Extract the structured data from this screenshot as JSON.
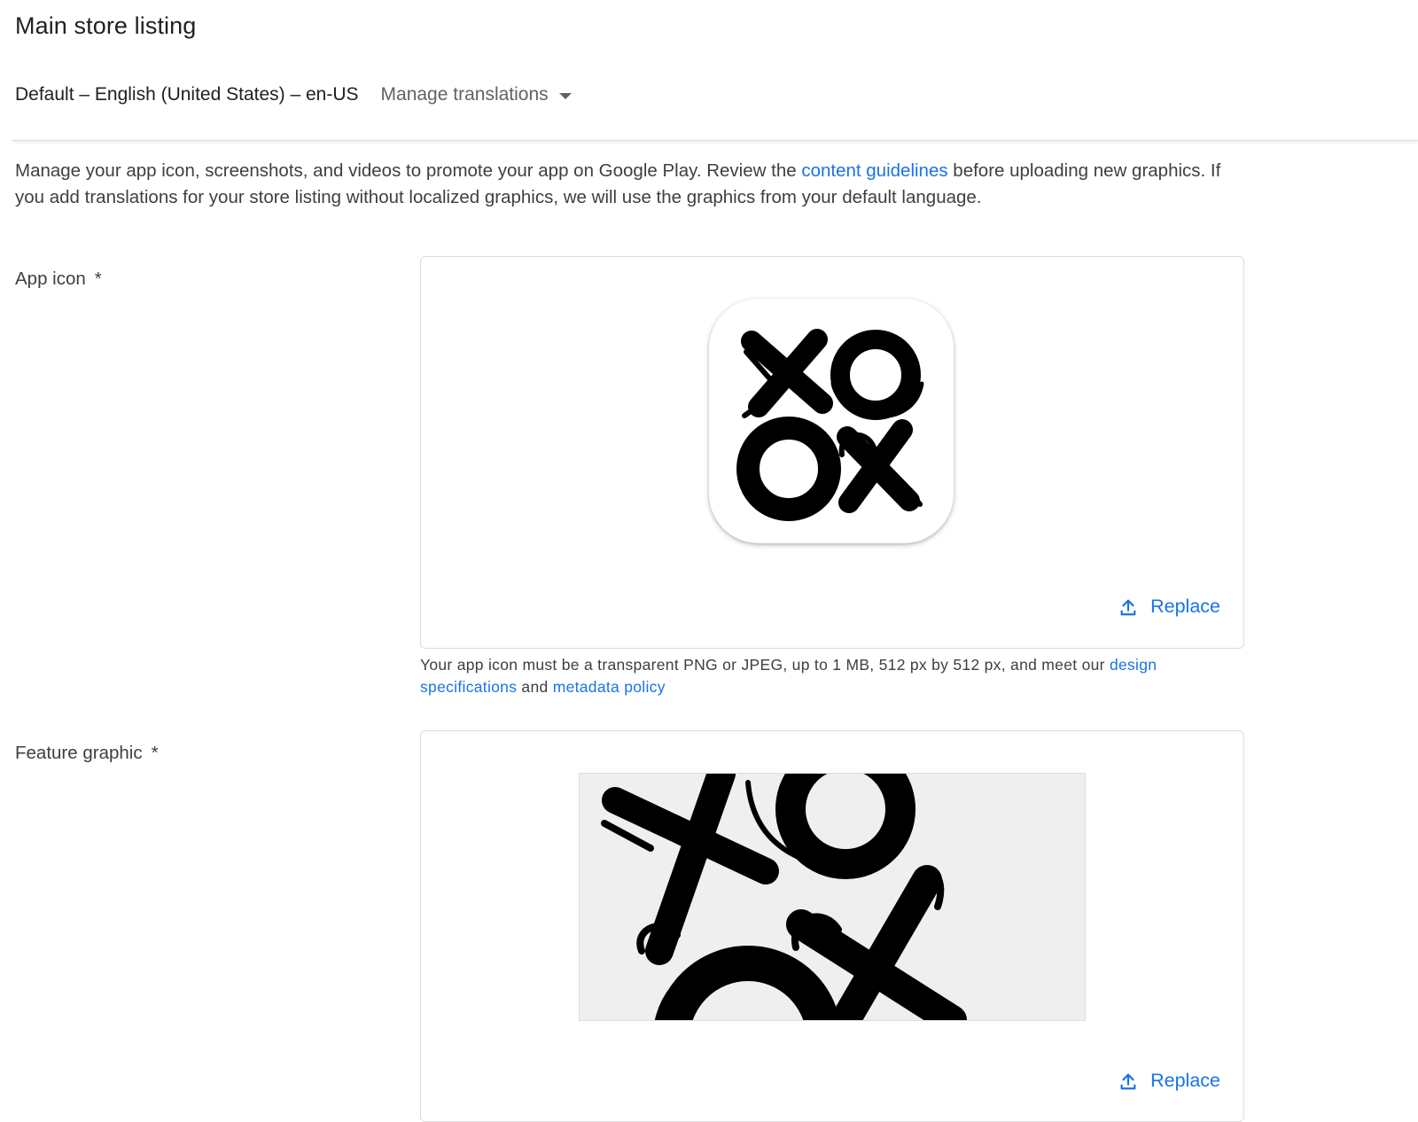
{
  "page": {
    "title": "Main store listing"
  },
  "language": {
    "default_label": "Default – English (United States) – en-US",
    "manage_translations_label": "Manage translations"
  },
  "intro": {
    "text_before": "Manage your app icon, screenshots, and videos to promote your app on Google Play. Review the ",
    "link": "content guidelines",
    "text_after": " before uploading new graphics. If you add translations for your store listing without localized graphics, we will use the graphics from your default language."
  },
  "app_icon": {
    "label": "App icon",
    "required_mark": "*",
    "replace_label": "Replace",
    "help_before": "Your app icon must be a transparent PNG or JPEG, up to 1 MB, 512 px by 512 px, and meet our ",
    "help_link_1": "design specifications",
    "help_middle": " and ",
    "help_link_2": "metadata policy"
  },
  "feature_graphic": {
    "label": "Feature graphic",
    "required_mark": "*",
    "replace_label": "Replace"
  },
  "colors": {
    "link": "#1a73e8",
    "text": "#202124",
    "secondary_text": "#5f6368",
    "border": "#dadce0"
  }
}
